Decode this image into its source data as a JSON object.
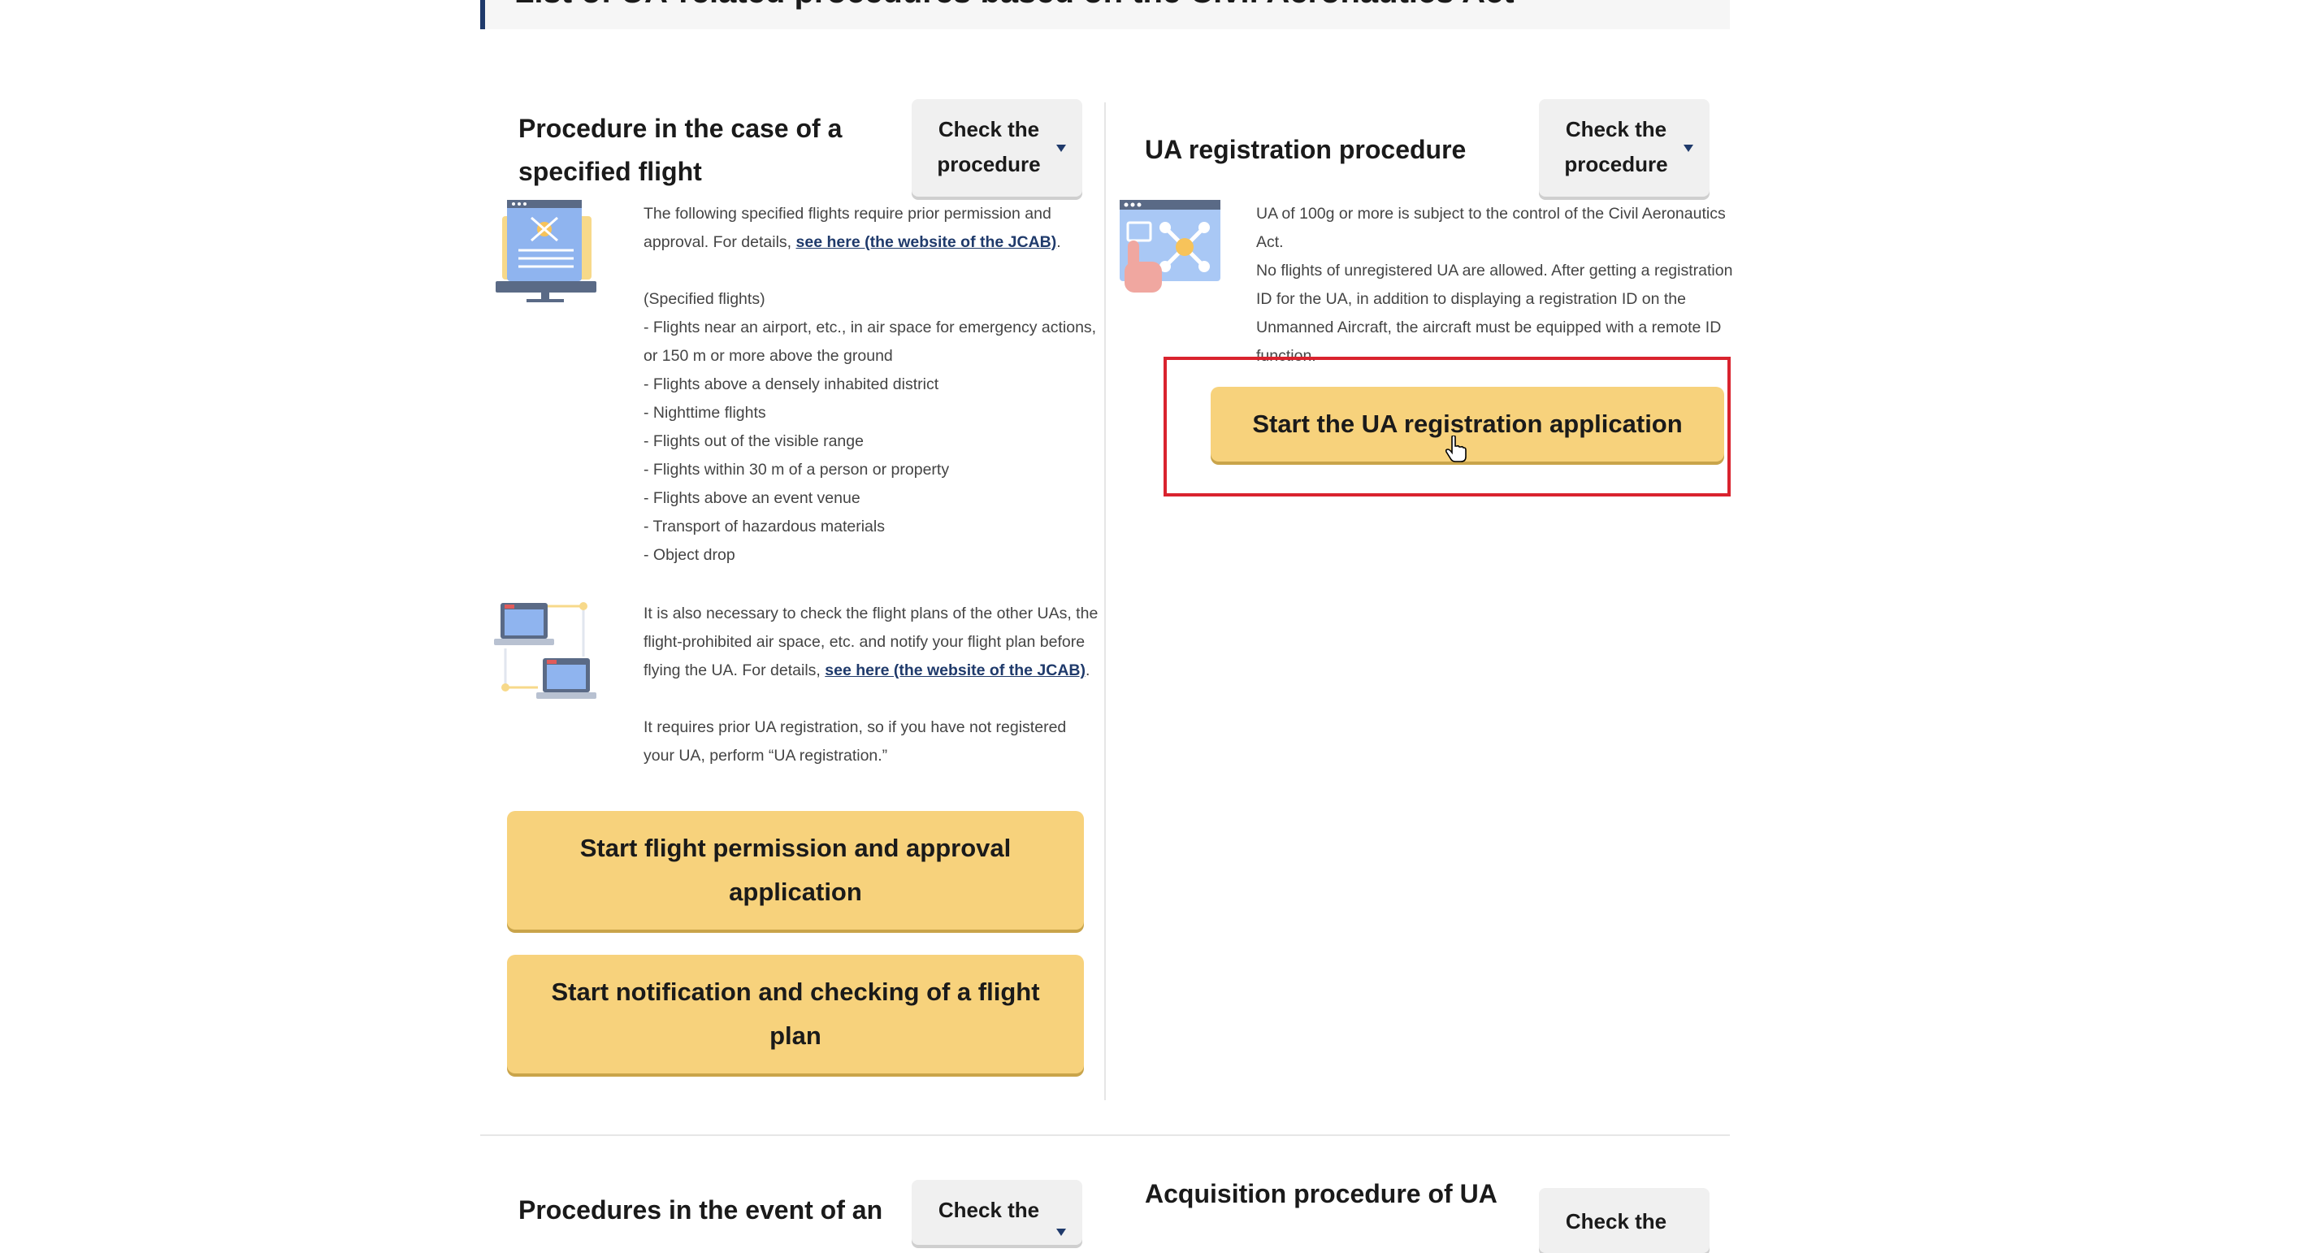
{
  "section": {
    "heading": "List of UA-related procedures based on the Civil Aeronautics Act"
  },
  "card_specified_flight": {
    "title_line1": "Procedure in the case of a",
    "title_line2": "specified flight",
    "check_line1": "Check the",
    "check_line2": "procedure",
    "intro_pre": "The following specified flights require prior permission and approval. For details, ",
    "intro_link": "see here (the website of the JCAB)",
    "intro_post": ".",
    "list_heading": "(Specified flights)",
    "list": [
      "- Flights near an airport, etc., in air space for emergency actions, or 150 m or more above the ground",
      "- Flights above a densely inhabited district",
      "- Nighttime flights",
      "- Flights out of the visible range",
      "- Flights within 30 m of a person or property",
      "- Flights above an event venue",
      "- Transport of hazardous materials",
      "- Object drop"
    ],
    "plan_pre": "It is also necessary to check the flight plans of the other UAs, the flight-prohibited air space, etc. and notify your flight plan before flying the UA. For details, ",
    "plan_link": "see here (the website of the JCAB)",
    "plan_post": ".",
    "registration_note": "It requires prior UA registration, so if you have not registered your UA, perform “UA registration.”",
    "btn_permission": "Start flight permission and approval application",
    "btn_notification": "Start notification and checking of a flight plan"
  },
  "card_registration": {
    "title": "UA registration procedure",
    "check_line1": "Check the",
    "check_line2": "procedure",
    "text1": "UA of 100g or more is subject to the control of the Civil Aeronautics Act.",
    "text2": "No flights of unregistered UA are allowed. After getting a registration ID for the UA, in addition to displaying a registration ID on the Unmanned Aircraft, the aircraft must be equipped with a remote ID function.",
    "btn_start": "Start the UA registration application"
  },
  "card_accident": {
    "title": "Procedures in the event of an",
    "check_line1": "Check the"
  },
  "card_acquisition": {
    "title": "Acquisition procedure of UA",
    "check_line1": "Check the"
  },
  "icons": [
    "monitor-drone-icon",
    "network-computers-icon",
    "drone-register-icon",
    "hand-pointer-icon"
  ],
  "colors": {
    "accent_button": "#f7d27c",
    "heading_bar": "#1f3a6b",
    "link": "#1f3a6b",
    "highlight": "#d9232e"
  }
}
